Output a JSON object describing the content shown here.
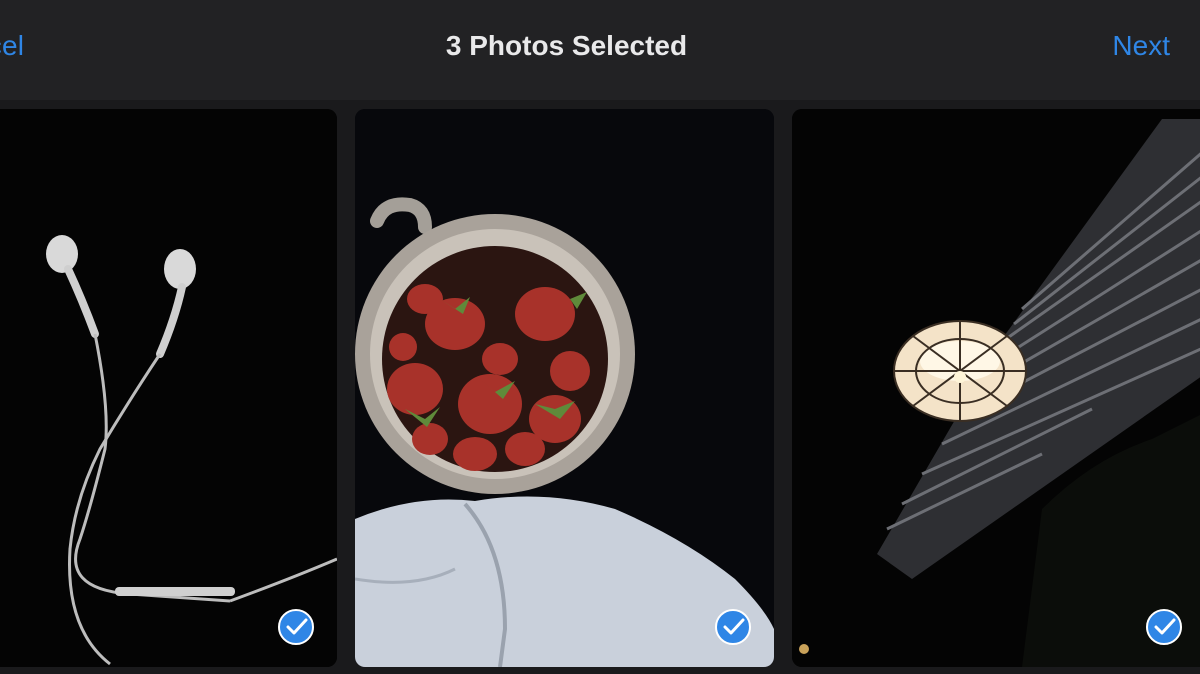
{
  "nav": {
    "cancel_label": "ncel",
    "title": "3 Photos Selected",
    "next_label": "Next"
  },
  "photos": [
    {
      "subject": "earphones",
      "selected": true
    },
    {
      "subject": "strawberries-in-cup",
      "selected": true
    },
    {
      "subject": "pendant-lamp",
      "selected": true
    }
  ],
  "colors": {
    "accent": "#2f86e6",
    "bar_bg": "#222224",
    "title_text": "#e9e9ea"
  }
}
